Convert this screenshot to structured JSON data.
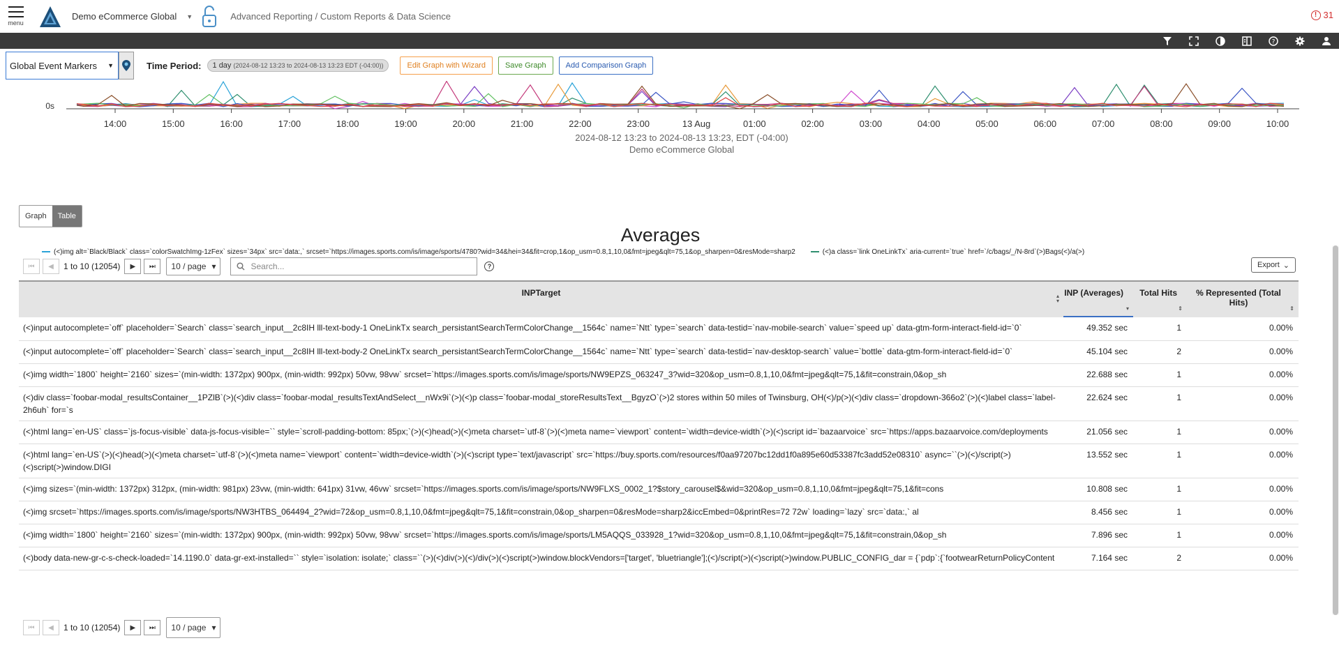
{
  "header": {
    "menu_label": "menu",
    "org_name": "Demo eCommerce Global",
    "breadcrumb": "Advanced Reporting / Custom Reports & Data Science",
    "alert_count": "31"
  },
  "darkbar": {
    "icons": [
      "filter-icon",
      "fullscreen-icon",
      "contrast-icon",
      "columns-icon",
      "help-icon",
      "settings-icon",
      "user-icon"
    ]
  },
  "toolbar": {
    "event_markers": "Global Event Markers",
    "time_period_label": "Time Period:",
    "time_period_value": "1 day",
    "time_period_range": "(2024-08-12 13:23 to 2024-08-13 13:23 EDT (-04:00))",
    "edit_wizard": "Edit Graph with Wizard",
    "save_graph": "Save Graph",
    "add_comparison": "Add Comparison Graph"
  },
  "chart": {
    "y_tick": "0s",
    "x_ticks": [
      "14:00",
      "15:00",
      "16:00",
      "17:00",
      "18:00",
      "19:00",
      "20:00",
      "21:00",
      "22:00",
      "23:00",
      "13 Aug",
      "01:00",
      "02:00",
      "03:00",
      "04:00",
      "05:00",
      "06:00",
      "07:00",
      "08:00",
      "09:00",
      "10:00"
    ],
    "range_label": "2024-08-12 13:23 to 2024-08-13 13:23, EDT (-04:00)",
    "org_label": "Demo eCommerce Global",
    "legend": [
      {
        "color": "#2aa3d8",
        "label": "(<)img alt=`Black/Black` class=`colorSwatchImg-1zFex` sizes=`34px` src=`data:,` srcset=`https://images.sports.com/is/image/sports/4780?wid=34&hei=34&fit=crop,1&op_usm=0.8,1,10,0&fmt=jpeg&qlt=75,1&op_sharpen=0&resMode=sharp2"
      },
      {
        "color": "#2f8f6f",
        "label": "(<)a class=`link OneLinkTx` aria-current=`true` href=`/c/bags/_/N-8rd`(>)Bags(<)/a(>)"
      }
    ]
  },
  "view_toggle": {
    "graph": "Graph",
    "table": "Table"
  },
  "report": {
    "title": "Averages",
    "pager_info": "1 to 10 (12054)",
    "page_size": "10 / page",
    "search_placeholder": "Search...",
    "export_label": "Export",
    "columns": [
      "INPTarget",
      "INP (Averages)",
      "Total Hits",
      "% Represented (Total Hits)"
    ],
    "rows": [
      {
        "target": "(<)input autocomplete=`off` placeholder=`Search` class=`search_input__2c8IH lll-text-body-1 OneLinkTx search_persistantSearchTermColorChange__1564c` name=`Ntt` type=`search` data-testid=`nav-mobile-search` value=`speed up` data-gtm-form-interact-field-id=`0`",
        "inp": "49.352 sec",
        "hits": "1",
        "pct": "0.00%"
      },
      {
        "target": "(<)input autocomplete=`off` placeholder=`Search` class=`search_input__2c8IH lll-text-body-2 OneLinkTx search_persistantSearchTermColorChange__1564c` name=`Ntt` type=`search` data-testid=`nav-desktop-search` value=`bottle` data-gtm-form-interact-field-id=`0`",
        "inp": "45.104 sec",
        "hits": "2",
        "pct": "0.00%"
      },
      {
        "target": "(<)img width=`1800` height=`2160` sizes=`(min-width: 1372px) 900px, (min-width: 992px) 50vw, 98vw` srcset=`https://images.sports.com/is/image/sports/NW9EPZS_063247_3?wid=320&op_usm=0.8,1,10,0&fmt=jpeg&qlt=75,1&fit=constrain,0&op_sh",
        "inp": "22.688 sec",
        "hits": "1",
        "pct": "0.00%"
      },
      {
        "target": "(<)div class=`foobar-modal_resultsContainer__1PZlB`(>)(<)div class=`foobar-modal_resultsTextAndSelect__nWx9i`(>)(<)p class=`foobar-modal_storeResultsText__BgyzO`(>)2 stores within 50 miles of Twinsburg, OH(<)/p(>)(<)div class=`dropdown-366o2`(>)(<)label class=`label-2h6uh` for=`s",
        "inp": "22.624 sec",
        "hits": "1",
        "pct": "0.00%"
      },
      {
        "target": "(<)html lang=`en-US` class=`js-focus-visible` data-js-focus-visible=`` style=`scroll-padding-bottom: 85px;`(>)(<)head(>)(<)meta charset=`utf-8`(>)(<)meta name=`viewport` content=`width=device-width`(>)(<)script id=`bazaarvoice` src=`https://apps.bazaarvoice.com/deployments",
        "inp": "21.056 sec",
        "hits": "1",
        "pct": "0.00%"
      },
      {
        "target": "(<)html lang=`en-US`(>)(<)head(>)(<)meta charset=`utf-8`(>)(<)meta name=`viewport` content=`width=device-width`(>)(<)script type=`text/javascript` src=`https://buy.sports.com/resources/f0aa97207bc12dd1f0a895e60d53387fc3add52e08310` async=``(>)(<)/script(>)(<)script(>)window.DIGI",
        "inp": "13.552 sec",
        "hits": "1",
        "pct": "0.00%"
      },
      {
        "target": "(<)img sizes=`(min-width: 1372px) 312px, (min-width: 981px) 23vw, (min-width: 641px) 31vw, 46vw` srcset=`https://images.sports.com/is/image/sports/NW9FLXS_0002_1?$story_carousel$&wid=320&op_usm=0.8,1,10,0&fmt=jpeg&qlt=75,1&fit=cons",
        "inp": "10.808 sec",
        "hits": "1",
        "pct": "0.00%"
      },
      {
        "target": "(<)img srcset=`https://images.sports.com/is/image/sports/NW3HTBS_064494_2?wid=72&op_usm=0.8,1,10,0&fmt=jpeg&qlt=75,1&fit=constrain,0&op_sharpen=0&resMode=sharp2&iccEmbed=0&printRes=72 72w` loading=`lazy` src=`data:,` al",
        "inp": "8.456 sec",
        "hits": "1",
        "pct": "0.00%"
      },
      {
        "target": "(<)img width=`1800` height=`2160` sizes=`(min-width: 1372px) 900px, (min-width: 992px) 50vw, 98vw` srcset=`https://images.sports.com/is/image/sports/LM5AQQS_033928_1?wid=320&op_usm=0.8,1,10,0&fmt=jpeg&qlt=75,1&fit=constrain,0&op_sh",
        "inp": "7.896 sec",
        "hits": "1",
        "pct": "0.00%"
      },
      {
        "target": "(<)body data-new-gr-c-s-check-loaded=`14.1190.0` data-gr-ext-installed=`` style=`isolation: isolate;` class=``(>)(<)div(>)(<)/div(>)(<)script(>)window.blockVendors=['target', 'bluetriangle'];(<)/script(>)(<)script(>)window.PUBLIC_CONFIG_dar = {`pdp`:{`footwearReturnPolicyContent",
        "inp": "7.164 sec",
        "hits": "2",
        "pct": "0.00%"
      }
    ]
  }
}
